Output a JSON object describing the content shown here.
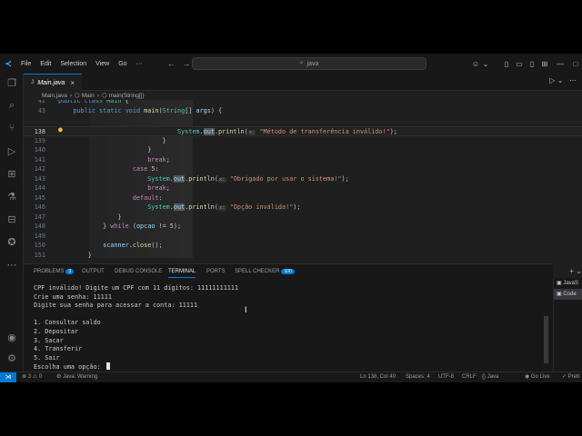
{
  "titlebar": {
    "menus": [
      "File",
      "Edit",
      "Selection",
      "View",
      "Go",
      "···"
    ],
    "search_text": "java"
  },
  "tab": {
    "label": "Main.java",
    "close": "×"
  },
  "breadcrumb": {
    "file": "Main.java",
    "class": "Main",
    "method": "main(String[])"
  },
  "editor": {
    "lines": [
      {
        "num": "42",
        "html": "<span class='k'>public</span> <span class='k'>class</span> <span class='t'>Main</span> {"
      },
      {
        "num": "43",
        "html": "    <span class='k'>public</span> <span class='k'>static</span> <span class='k'>void</span> <span class='f'>main</span>(<span class='t'>String</span>[] <span class='v'>args</span>) {"
      },
      {
        "num": "138",
        "html": "                                <span class='t'>System</span>.<span class='v hl'>out</span>.<span class='f'>println</span>(<span class='hint'>x:</span> <span class='s'>\"Método de transferência inválido!\"</span>);",
        "current": true
      },
      {
        "num": "139",
        "html": "                            }"
      },
      {
        "num": "140",
        "html": "                        }"
      },
      {
        "num": "141",
        "html": "                        <span class='c'>break</span>;"
      },
      {
        "num": "142",
        "html": "                    <span class='c'>case</span> <span class='n'>5</span>:"
      },
      {
        "num": "143",
        "html": "                        <span class='t'>System</span>.<span class='v hl'>out</span>.<span class='f'>println</span>(<span class='hint'>x:</span> <span class='s'>\"Obrigado por usar o sistema!\"</span>);"
      },
      {
        "num": "144",
        "html": "                        <span class='c'>break</span>;"
      },
      {
        "num": "145",
        "html": "                    <span class='c'>default</span>:"
      },
      {
        "num": "146",
        "html": "                        <span class='t'>System</span>.<span class='v hl'>out</span>.<span class='f'>println</span>(<span class='hint'>x:</span> <span class='s'>\"Opção inválida!\"</span>);"
      },
      {
        "num": "147",
        "html": "                }"
      },
      {
        "num": "148",
        "html": "            } <span class='c'>while</span> (<span class='v'>opcao</span> != <span class='n'>5</span>);"
      },
      {
        "num": "149",
        "html": ""
      },
      {
        "num": "150",
        "html": "            <span class='v'>scanner</span>.<span class='f'>close</span>();"
      },
      {
        "num": "151",
        "html": "        }"
      },
      {
        "num": "152",
        "html": "}"
      }
    ]
  },
  "panel": {
    "tabs": [
      {
        "label": "PROBLEMS",
        "badge": "3"
      },
      {
        "label": "OUTPUT"
      },
      {
        "label": "DEBUG CONSOLE"
      },
      {
        "label": "TERMINAL",
        "active": true
      },
      {
        "label": "PORTS"
      },
      {
        "label": "SPELL CHECKER",
        "badge": "100"
      }
    ],
    "terminal_lines": [
      "CPF inválido! Digite um CPF com 11 dígitos: 11111111111",
      "Crie uma senha: 11111",
      "Digite sua senha para acessar a conta: 11111",
      "",
      "1. Consultar saldo",
      "2. Depositar",
      "3. Sacar",
      "4. Transferir",
      "5. Sair",
      "Escolha uma opção: "
    ],
    "terminal_list": [
      "JavaS",
      "Code"
    ]
  },
  "status": {
    "errors": "3",
    "warnings": "0",
    "java": "Java: Warning",
    "position": "Ln 138, Col 40",
    "spaces": "Spaces: 4",
    "encoding": "UTF-8",
    "eol": "CRLF",
    "language": "Java",
    "golive": "Go Live",
    "prettier": "Prett"
  },
  "colors": {
    "accent": "#0078d4",
    "background": "#1f1f1f"
  }
}
